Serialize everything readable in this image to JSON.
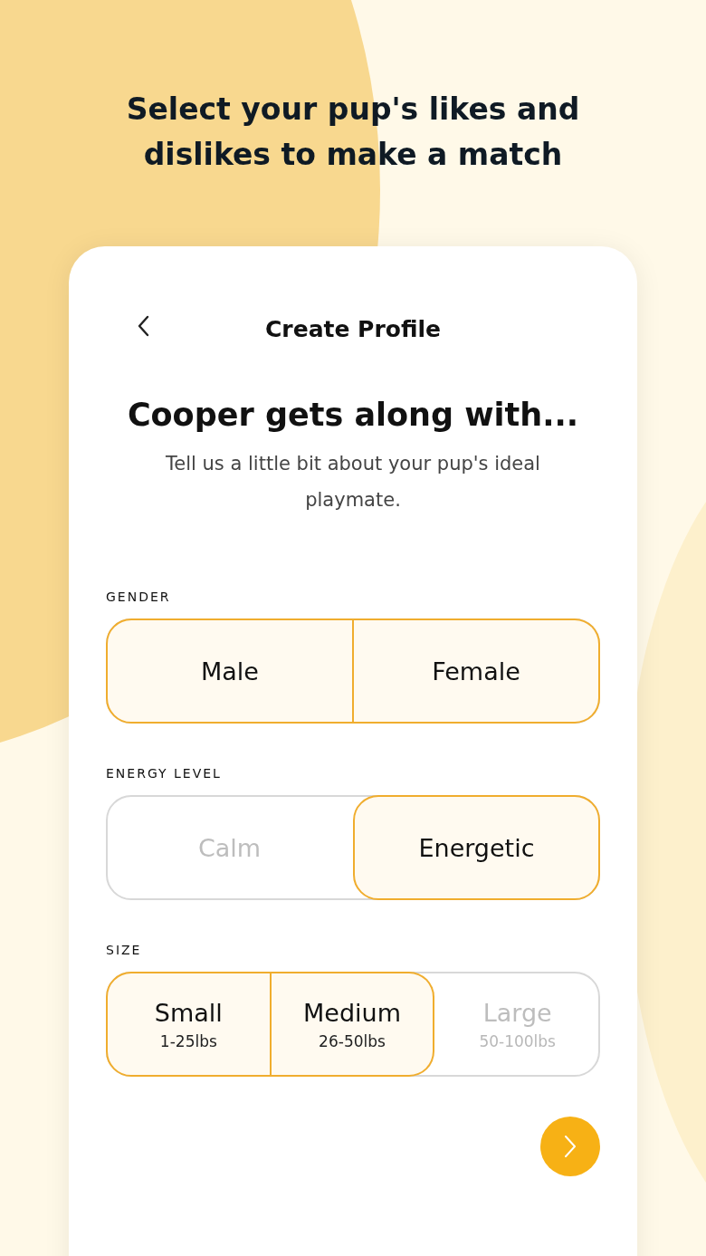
{
  "headline": "Select your pup's likes and dislikes to make a match",
  "card": {
    "title": "Create Profile",
    "heading": "Cooper gets along with...",
    "subtitle": "Tell us a little bit about your pup's ideal playmate."
  },
  "groups": [
    {
      "label": "GENDER",
      "options": [
        {
          "label": "Male",
          "selected": true
        },
        {
          "label": "Female",
          "selected": true
        }
      ]
    },
    {
      "label": "ENERGY LEVEL",
      "options": [
        {
          "label": "Calm",
          "selected": false
        },
        {
          "label": "Energetic",
          "selected": true
        }
      ]
    },
    {
      "label": "SIZE",
      "options": [
        {
          "label": "Small",
          "sublabel": "1-25lbs",
          "selected": true
        },
        {
          "label": "Medium",
          "sublabel": "26-50lbs",
          "selected": true
        },
        {
          "label": "Large",
          "sublabel": "50-100lbs",
          "selected": false
        }
      ]
    }
  ]
}
